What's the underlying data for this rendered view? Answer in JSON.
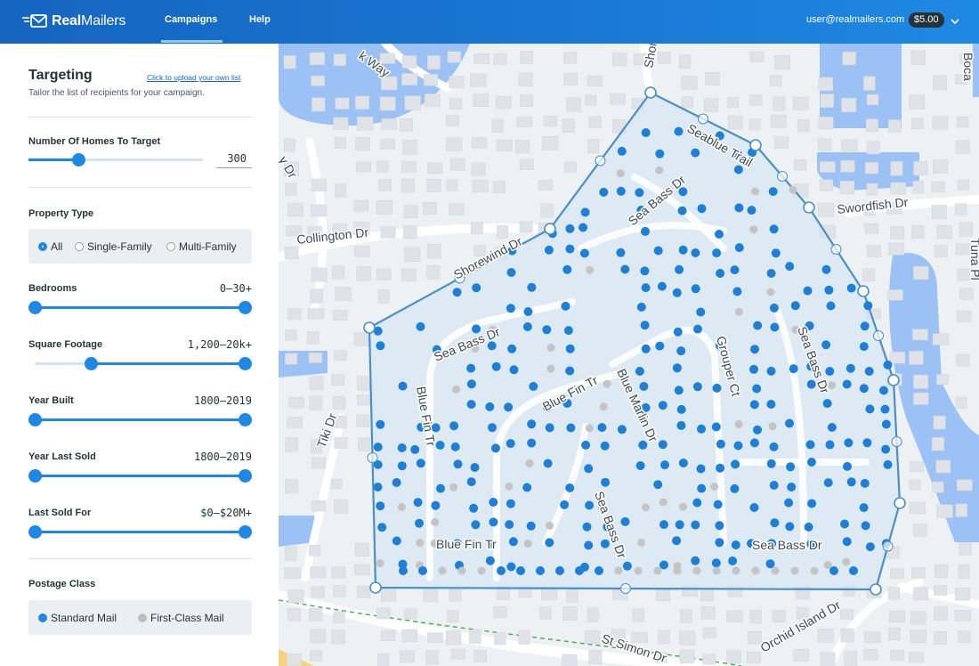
{
  "header": {
    "brand_bold": "Real",
    "brand_rest": "Mailers",
    "nav": [
      {
        "label": "Campaigns",
        "active": true
      },
      {
        "label": "Help",
        "active": false
      }
    ],
    "user_email": "user@realmailers.com",
    "balance": "$5.00",
    "logo_icon": "mail-icon",
    "menu_icon": "chevron-down-icon"
  },
  "sidebar": {
    "title": "Targeting",
    "subtitle": "Tailor the list of recipients for your campaign.",
    "upload_link": "Click to upload your own list",
    "homes": {
      "label": "Number Of Homes To Target",
      "value": "300",
      "level": 0.29
    },
    "property_type": {
      "label": "Property Type",
      "options": [
        "All",
        "Single-Family",
        "Multi-Family"
      ],
      "selected": "All"
    },
    "filters": [
      {
        "label": "Bedrooms",
        "value": "0–30+",
        "low": 0.0,
        "high": 1.0
      },
      {
        "label": "Square Footage",
        "value": "1,200–20k+",
        "low": 0.27,
        "high": 1.0
      },
      {
        "label": "Year Built",
        "value": "1800–2019",
        "low": 0.0,
        "high": 1.0
      },
      {
        "label": "Year Last Sold",
        "value": "1800–2019",
        "low": 0.0,
        "high": 1.0
      },
      {
        "label": "Last Sold For",
        "value": "$0–$20M+",
        "low": 0.0,
        "high": 1.0
      }
    ],
    "postage": {
      "label": "Postage Class",
      "options": [
        "Standard Mail",
        "First-Class Mail"
      ],
      "selected": "Standard Mail"
    }
  },
  "map": {
    "streets": [
      "Seablue Trail",
      "Swordfish Dr",
      "Collington Dr",
      "Shorewind Dr",
      "Sea Bass Dr",
      "Blue Fin Tr",
      "Blue Marlin Dr",
      "Grouper Ct",
      "Tiki Dr",
      "St Simon Dr",
      "Orchid Island Dr",
      "k Way",
      "y Dr",
      "Shor",
      "Boca",
      "Tuna Pl"
    ],
    "colors": {
      "water": "#9cc2f5",
      "selection_outline": "#4a90c8",
      "selected_home": "#1e7fd6",
      "excluded_home": "#c4c4c4"
    }
  }
}
